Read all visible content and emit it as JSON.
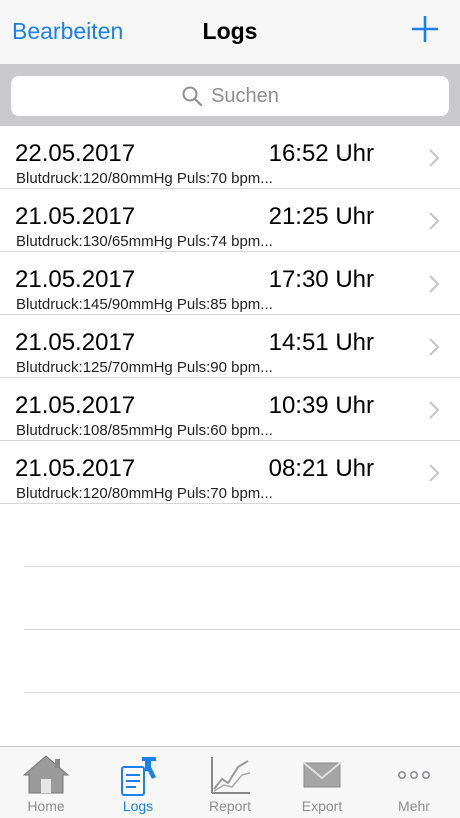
{
  "nav": {
    "edit_label": "Bearbeiten",
    "title": "Logs",
    "add_icon": "plus-icon"
  },
  "search": {
    "placeholder": "Suchen",
    "icon": "magnifier-icon"
  },
  "logs": [
    {
      "date": "22.05.2017",
      "time": "16:52 Uhr",
      "detail": "Blutdruck:120/80mmHg Puls:70 bpm..."
    },
    {
      "date": "21.05.2017",
      "time": "21:25 Uhr",
      "detail": "Blutdruck:130/65mmHg Puls:74 bpm..."
    },
    {
      "date": "21.05.2017",
      "time": "17:30 Uhr",
      "detail": "Blutdruck:145/90mmHg Puls:85 bpm..."
    },
    {
      "date": "21.05.2017",
      "time": "14:51 Uhr",
      "detail": "Blutdruck:125/70mmHg Puls:90 bpm..."
    },
    {
      "date": "21.05.2017",
      "time": "10:39 Uhr",
      "detail": "Blutdruck:108/85mmHg Puls:60 bpm..."
    },
    {
      "date": "21.05.2017",
      "time": "08:21 Uhr",
      "detail": "Blutdruck:120/80mmHg Puls:70 bpm..."
    }
  ],
  "tabs": [
    {
      "label": "Home",
      "icon": "house-icon"
    },
    {
      "label": "Logs",
      "icon": "logs-icon",
      "active": true
    },
    {
      "label": "Report",
      "icon": "chart-icon"
    },
    {
      "label": "Export",
      "icon": "envelope-icon"
    },
    {
      "label": "Mehr",
      "icon": "more-icon"
    }
  ],
  "colors": {
    "accent": "#1a7ff0",
    "inactive": "#8e8e93",
    "separator": "#d6d6da"
  }
}
